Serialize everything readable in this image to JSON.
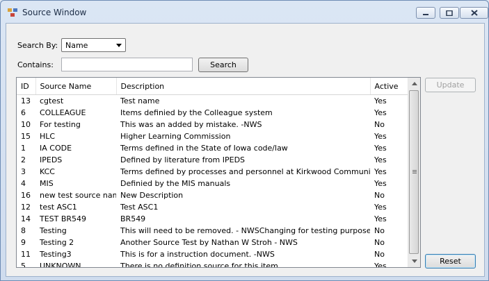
{
  "window": {
    "title": "Source Window"
  },
  "search": {
    "search_by_label": "Search By:",
    "search_by_value": "Name",
    "contains_label": "Contains:",
    "contains_value": "",
    "search_button": "Search"
  },
  "buttons": {
    "update": "Update",
    "reset": "Reset"
  },
  "table": {
    "headers": [
      "ID",
      "Source Name",
      "Description",
      "Active"
    ],
    "rows": [
      [
        "13",
        "cgtest",
        "Test name",
        "Yes"
      ],
      [
        "6",
        "COLLEAGUE",
        "Items definied by the Colleague system",
        "Yes"
      ],
      [
        "10",
        "For testing",
        "This was an added by mistake. -NWS",
        "No"
      ],
      [
        "15",
        "HLC",
        "Higher Learning Commission",
        "Yes"
      ],
      [
        "1",
        "IA CODE",
        "Terms defined in the State of Iowa code/law",
        "Yes"
      ],
      [
        "2",
        "IPEDS",
        "Defined by literature from IPEDS",
        "Yes"
      ],
      [
        "3",
        "KCC",
        "Terms defined by processes and personnel at Kirkwood Community College",
        "Yes"
      ],
      [
        "4",
        "MIS",
        "Definied by the MIS manuals",
        "Yes"
      ],
      [
        "16",
        "new test source name",
        "New Description",
        "No"
      ],
      [
        "12",
        "test ASC1",
        "Test ASC1",
        "Yes"
      ],
      [
        "14",
        "TEST BR549",
        "BR549",
        "Yes"
      ],
      [
        "8",
        "Testing",
        "This will need to be removed. - NWSChanging for testing purposes",
        "No"
      ],
      [
        "9",
        "Testing 2",
        "Another Source Test by Nathan W Stroh - NWS",
        "No"
      ],
      [
        "11",
        "Testing3",
        "This is for a instruction document. -NWS",
        "No"
      ],
      [
        "5",
        "UNKNOWN",
        "There is no definition source for this item",
        "Yes"
      ]
    ]
  }
}
